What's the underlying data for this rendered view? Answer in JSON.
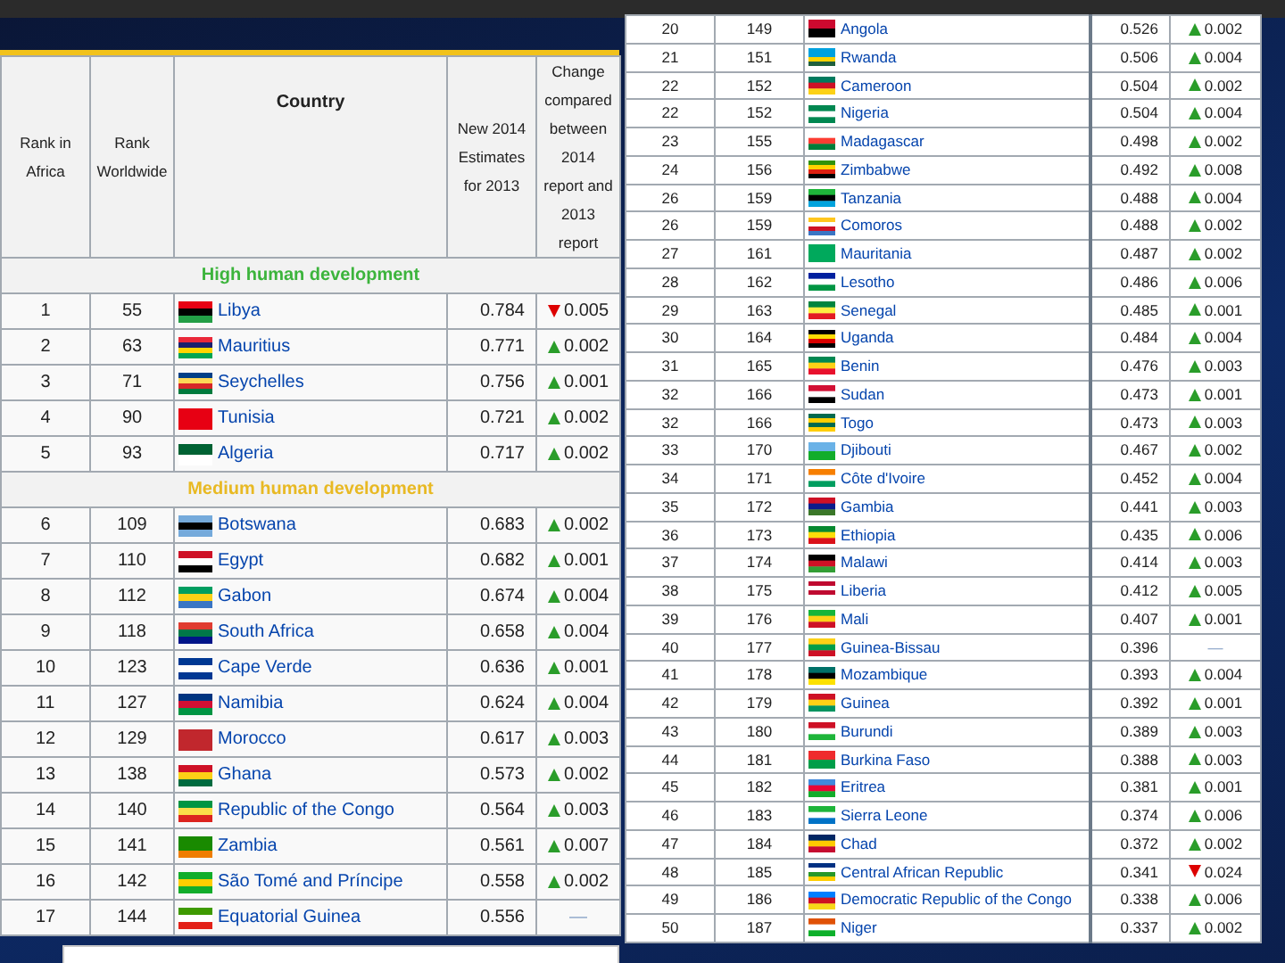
{
  "tables": [
    {
      "columns": [
        "Rank in Africa",
        "Rank Worldwide",
        "Country",
        "New 2014 Estimates for 2013",
        "Change compared between 2014 report and 2013 report"
      ],
      "rows": [
        {
          "kind": "high",
          "label": "High human development"
        },
        {
          "kind": "country",
          "rank_africa": "1",
          "rank_world": "55",
          "country": "Libya",
          "hdi": "0.784",
          "increase": false,
          "change": "0.005"
        },
        {
          "kind": "country",
          "rank_africa": "2",
          "rank_world": "63",
          "country": "Mauritius",
          "hdi": "0.771",
          "increase": true,
          "change": "0.002"
        },
        {
          "kind": "country",
          "rank_africa": "3",
          "rank_world": "71",
          "country": "Seychelles",
          "hdi": "0.756",
          "increase": true,
          "change": "0.001"
        },
        {
          "kind": "country",
          "rank_africa": "4",
          "rank_world": "90",
          "country": "Tunisia",
          "hdi": "0.721",
          "increase": true,
          "change": "0.002"
        },
        {
          "kind": "country",
          "rank_africa": "5",
          "rank_world": "93",
          "country": "Algeria",
          "hdi": "0.717",
          "increase": true,
          "change": "0.002"
        },
        {
          "kind": "medium",
          "label": "Medium human development"
        },
        {
          "kind": "country",
          "rank_africa": "6",
          "rank_world": "109",
          "country": "Botswana",
          "hdi": "0.683",
          "increase": true,
          "change": "0.002"
        },
        {
          "kind": "country",
          "rank_africa": "7",
          "rank_world": "110",
          "country": "Egypt",
          "hdi": "0.682",
          "increase": true,
          "change": "0.001"
        },
        {
          "kind": "country",
          "rank_africa": "8",
          "rank_world": "112",
          "country": "Gabon",
          "hdi": "0.674",
          "increase": true,
          "change": "0.004"
        },
        {
          "kind": "country",
          "rank_africa": "9",
          "rank_world": "118",
          "country": "South Africa",
          "hdi": "0.658",
          "increase": true,
          "change": "0.004"
        },
        {
          "kind": "country",
          "rank_africa": "10",
          "rank_world": "123",
          "country": "Cape Verde",
          "hdi": "0.636",
          "increase": true,
          "change": "0.001"
        },
        {
          "kind": "country",
          "rank_africa": "11",
          "rank_world": "127",
          "country": "Namibia",
          "hdi": "0.624",
          "increase": true,
          "change": "0.004"
        },
        {
          "kind": "country",
          "rank_africa": "12",
          "rank_world": "129",
          "country": "Morocco",
          "hdi": "0.617",
          "increase": true,
          "change": "0.003"
        },
        {
          "kind": "country",
          "rank_africa": "13",
          "rank_world": "138",
          "country": "Ghana",
          "hdi": "0.573",
          "increase": true,
          "change": "0.002"
        },
        {
          "kind": "country",
          "rank_africa": "14",
          "rank_world": "140",
          "country": "Republic of the Congo",
          "hdi": "0.564",
          "increase": true,
          "change": "0.003"
        },
        {
          "kind": "country",
          "rank_africa": "15",
          "rank_world": "141",
          "country": "Zambia",
          "hdi": "0.561",
          "increase": true,
          "change": "0.007"
        },
        {
          "kind": "country",
          "rank_africa": "16",
          "rank_world": "142",
          "country": "São Tomé and Príncipe",
          "hdi": "0.558",
          "increase": true,
          "change": "0.002"
        },
        {
          "kind": "country",
          "rank_africa": "17",
          "rank_world": "144",
          "country": "Equatorial Guinea",
          "hdi": "0.556",
          "change": "—"
        }
      ]
    },
    {
      "rows": [
        {
          "kind": "country",
          "rank_africa": "20",
          "rank_world": "149",
          "country": "Angola",
          "hdi": "0.526",
          "increase": true,
          "change": "0.002"
        },
        {
          "kind": "country",
          "rank_africa": "21",
          "rank_world": "151",
          "country": "Rwanda",
          "hdi": "0.506",
          "increase": true,
          "change": "0.004"
        },
        {
          "kind": "country",
          "rank_africa": "22",
          "rank_world": "152",
          "country": "Cameroon",
          "hdi": "0.504",
          "increase": true,
          "change": "0.002"
        },
        {
          "kind": "country",
          "rank_africa": "22",
          "rank_world": "152",
          "country": "Nigeria",
          "hdi": "0.504",
          "increase": true,
          "change": "0.004"
        },
        {
          "kind": "country",
          "rank_africa": "23",
          "rank_world": "155",
          "country": "Madagascar",
          "hdi": "0.498",
          "increase": true,
          "change": "0.002"
        },
        {
          "kind": "country",
          "rank_africa": "24",
          "rank_world": "156",
          "country": "Zimbabwe",
          "hdi": "0.492",
          "increase": true,
          "change": "0.008"
        },
        {
          "kind": "country",
          "rank_africa": "26",
          "rank_world": "159",
          "country": "Tanzania",
          "hdi": "0.488",
          "increase": true,
          "change": "0.004"
        },
        {
          "kind": "country",
          "rank_africa": "26",
          "rank_world": "159",
          "country": "Comoros",
          "hdi": "0.488",
          "increase": true,
          "change": "0.002"
        },
        {
          "kind": "country",
          "rank_africa": "27",
          "rank_world": "161",
          "country": "Mauritania",
          "hdi": "0.487",
          "increase": true,
          "change": "0.002"
        },
        {
          "kind": "country",
          "rank_africa": "28",
          "rank_world": "162",
          "country": "Lesotho",
          "hdi": "0.486",
          "increase": true,
          "change": "0.006"
        },
        {
          "kind": "country",
          "rank_africa": "29",
          "rank_world": "163",
          "country": "Senegal",
          "hdi": "0.485",
          "increase": true,
          "change": "0.001"
        },
        {
          "kind": "country",
          "rank_africa": "30",
          "rank_world": "164",
          "country": "Uganda",
          "hdi": "0.484",
          "increase": true,
          "change": "0.004"
        },
        {
          "kind": "country",
          "rank_africa": "31",
          "rank_world": "165",
          "country": "Benin",
          "hdi": "0.476",
          "increase": true,
          "change": "0.003"
        },
        {
          "kind": "country",
          "rank_africa": "32",
          "rank_world": "166",
          "country": "Sudan",
          "hdi": "0.473",
          "increase": true,
          "change": "0.001"
        },
        {
          "kind": "country",
          "rank_africa": "32",
          "rank_world": "166",
          "country": "Togo",
          "hdi": "0.473",
          "increase": true,
          "change": "0.003"
        },
        {
          "kind": "country",
          "rank_africa": "33",
          "rank_world": "170",
          "country": "Djibouti",
          "hdi": "0.467",
          "increase": true,
          "change": "0.002"
        },
        {
          "kind": "country",
          "rank_africa": "34",
          "rank_world": "171",
          "country": "Côte d'Ivoire",
          "hdi": "0.452",
          "increase": true,
          "change": "0.004"
        },
        {
          "kind": "country",
          "rank_africa": "35",
          "rank_world": "172",
          "country": "Gambia",
          "hdi": "0.441",
          "increase": true,
          "change": "0.003"
        },
        {
          "kind": "country",
          "rank_africa": "36",
          "rank_world": "173",
          "country": "Ethiopia",
          "hdi": "0.435",
          "increase": true,
          "change": "0.006"
        },
        {
          "kind": "country",
          "rank_africa": "37",
          "rank_world": "174",
          "country": "Malawi",
          "hdi": "0.414",
          "increase": true,
          "change": "0.003"
        },
        {
          "kind": "country",
          "rank_africa": "38",
          "rank_world": "175",
          "country": "Liberia",
          "hdi": "0.412",
          "increase": true,
          "change": "0.005"
        },
        {
          "kind": "country",
          "rank_africa": "39",
          "rank_world": "176",
          "country": "Mali",
          "hdi": "0.407",
          "increase": true,
          "change": "0.001"
        },
        {
          "kind": "country",
          "rank_africa": "40",
          "rank_world": "177",
          "country": "Guinea-Bissau",
          "hdi": "0.396",
          "change": "—"
        },
        {
          "kind": "country",
          "rank_africa": "41",
          "rank_world": "178",
          "country": "Mozambique",
          "hdi": "0.393",
          "increase": true,
          "change": "0.004"
        },
        {
          "kind": "country",
          "rank_africa": "42",
          "rank_world": "179",
          "country": "Guinea",
          "hdi": "0.392",
          "increase": true,
          "change": "0.001"
        },
        {
          "kind": "country",
          "rank_africa": "43",
          "rank_world": "180",
          "country": "Burundi",
          "hdi": "0.389",
          "increase": true,
          "change": "0.003"
        },
        {
          "kind": "country",
          "rank_africa": "44",
          "rank_world": "181",
          "country": "Burkina Faso",
          "hdi": "0.388",
          "increase": true,
          "change": "0.003"
        },
        {
          "kind": "country",
          "rank_africa": "45",
          "rank_world": "182",
          "country": "Eritrea",
          "hdi": "0.381",
          "increase": true,
          "change": "0.001"
        },
        {
          "kind": "country",
          "rank_africa": "46",
          "rank_world": "183",
          "country": "Sierra Leone",
          "hdi": "0.374",
          "increase": true,
          "change": "0.006"
        },
        {
          "kind": "country",
          "rank_africa": "47",
          "rank_world": "184",
          "country": "Chad",
          "hdi": "0.372",
          "increase": true,
          "change": "0.002"
        },
        {
          "kind": "country",
          "rank_africa": "48",
          "rank_world": "185",
          "country": "Central African Republic",
          "hdi": "0.341",
          "increase": false,
          "change": "0.024"
        },
        {
          "kind": "country",
          "rank_africa": "49",
          "rank_world": "186",
          "country": "Democratic Republic of the Congo",
          "hdi": "0.338",
          "increase": true,
          "change": "0.006"
        },
        {
          "kind": "country",
          "rank_africa": "50",
          "rank_world": "187",
          "country": "Niger",
          "hdi": "0.337",
          "increase": true,
          "change": "0.002"
        }
      ]
    }
  ]
}
